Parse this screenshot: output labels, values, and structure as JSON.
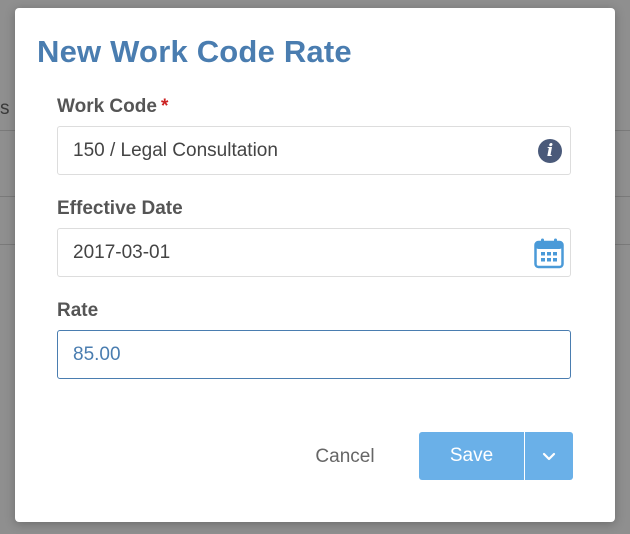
{
  "background": {
    "partial_text": "s"
  },
  "dialog": {
    "title": "New Work Code Rate",
    "fields": {
      "work_code": {
        "label": "Work Code",
        "required_marker": "*",
        "value": "150 / Legal Consultation",
        "icon": "info-icon"
      },
      "effective_date": {
        "label": "Effective Date",
        "value": "2017-03-01",
        "icon": "calendar-icon"
      },
      "rate": {
        "label": "Rate",
        "value": "85.00"
      }
    },
    "actions": {
      "cancel_label": "Cancel",
      "save_label": "Save",
      "save_menu_icon": "chevron-down-icon"
    }
  },
  "colors": {
    "title": "#4a7db0",
    "primary_button": "#6ab0e8",
    "required": "#cc2222",
    "focus_border": "#4a7db0"
  }
}
